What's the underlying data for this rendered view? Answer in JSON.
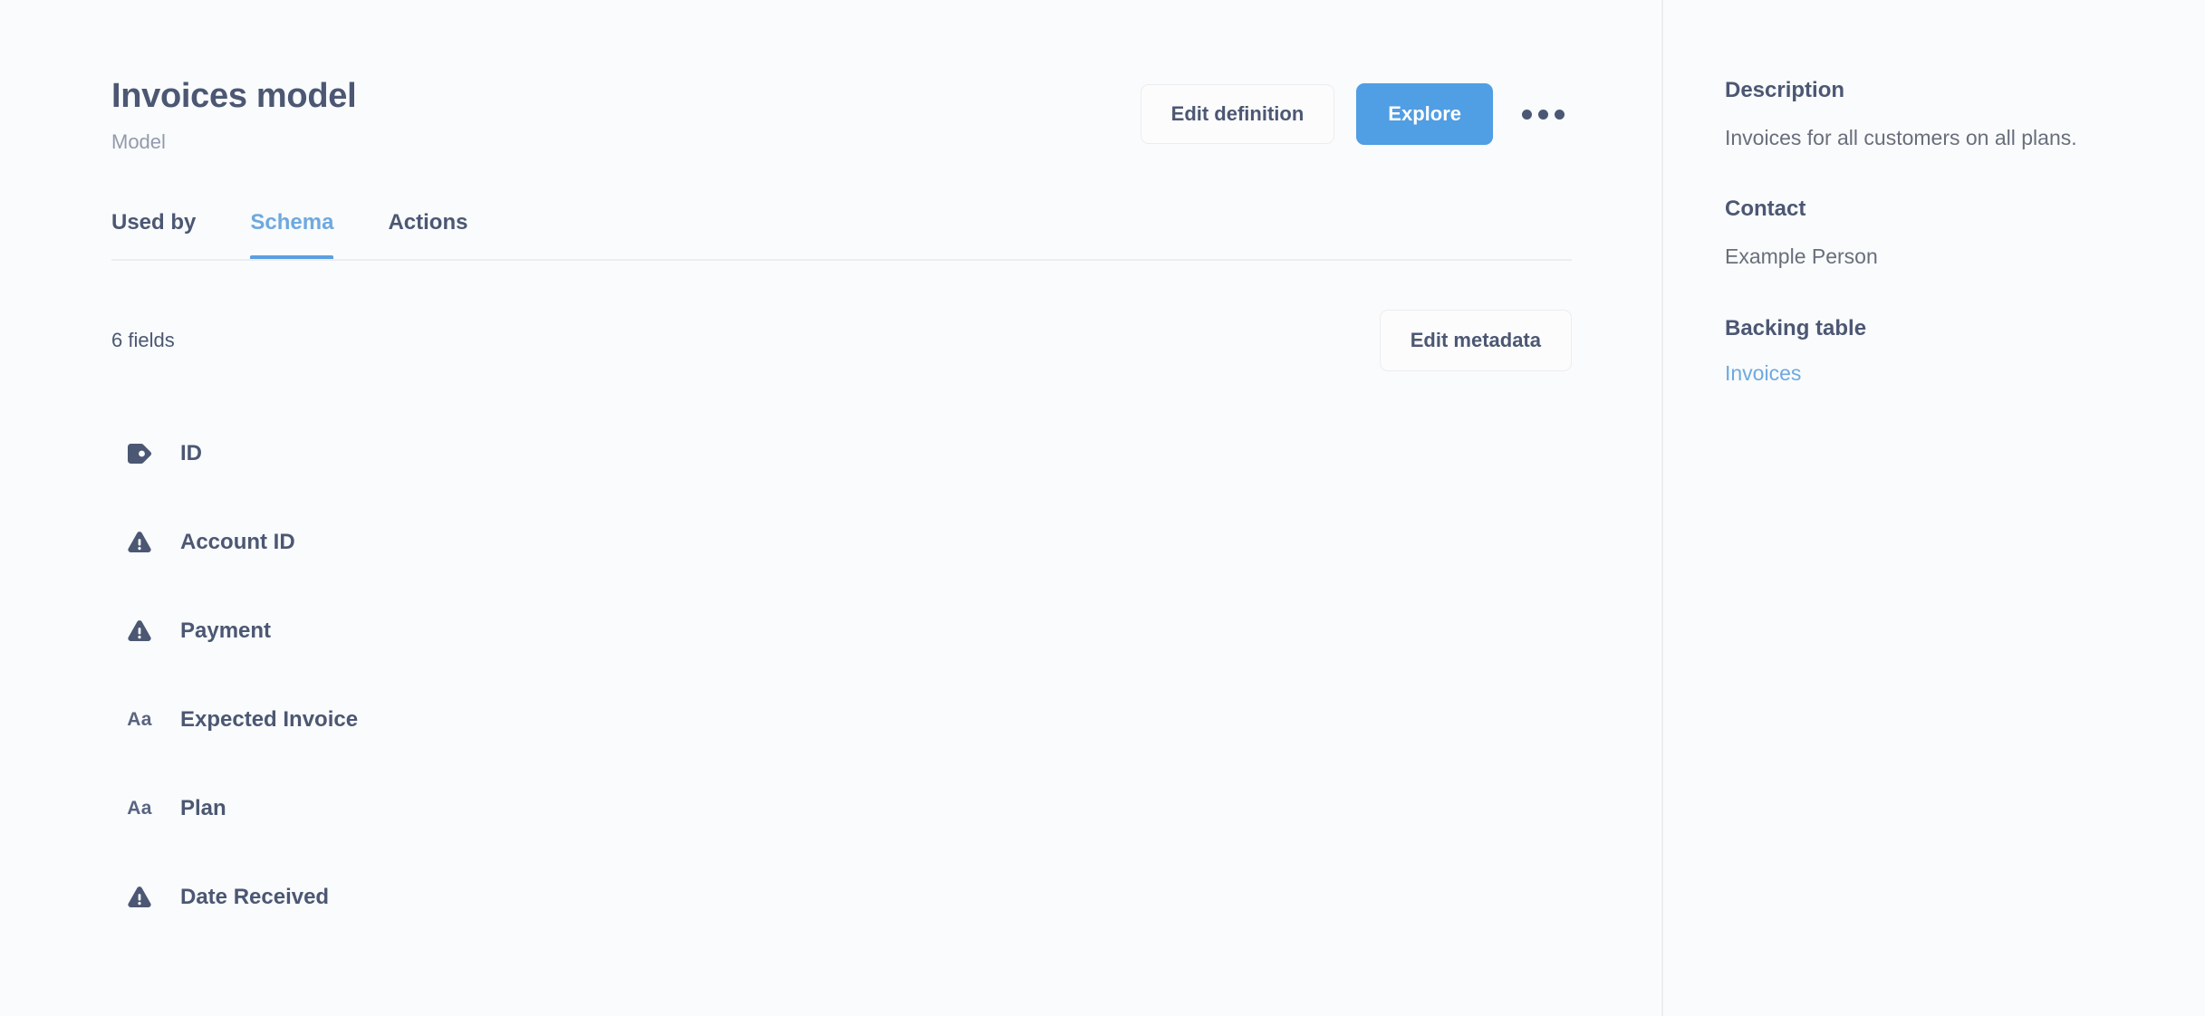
{
  "header": {
    "title": "Invoices model",
    "subtitle": "Model",
    "edit_definition_label": "Edit definition",
    "explore_label": "Explore",
    "more_menu_icon": "ellipsis-icon",
    "accent_color": "#509EE3"
  },
  "tabs": [
    {
      "label": "Used by",
      "active": false
    },
    {
      "label": "Schema",
      "active": true
    },
    {
      "label": "Actions",
      "active": false
    }
  ],
  "toolbar": {
    "fields_count": "6 fields",
    "edit_metadata_label": "Edit metadata"
  },
  "fields": [
    {
      "label": "ID",
      "icon": "tag-icon"
    },
    {
      "label": "Account ID",
      "icon": "warning-triangle-icon"
    },
    {
      "label": "Payment",
      "icon": "warning-triangle-icon"
    },
    {
      "label": "Expected Invoice",
      "icon": "text-aa-icon"
    },
    {
      "label": "Plan",
      "icon": "text-aa-icon"
    },
    {
      "label": "Date Received",
      "icon": "warning-triangle-icon"
    }
  ],
  "sidebar": {
    "description_heading": "Description",
    "description_text": "Invoices for all customers on all plans.",
    "contact_heading": "Contact",
    "contact_text": "Example Person",
    "backing_table_heading": "Backing table",
    "backing_table_link": "Invoices",
    "link_color": "#6EA9E0"
  }
}
